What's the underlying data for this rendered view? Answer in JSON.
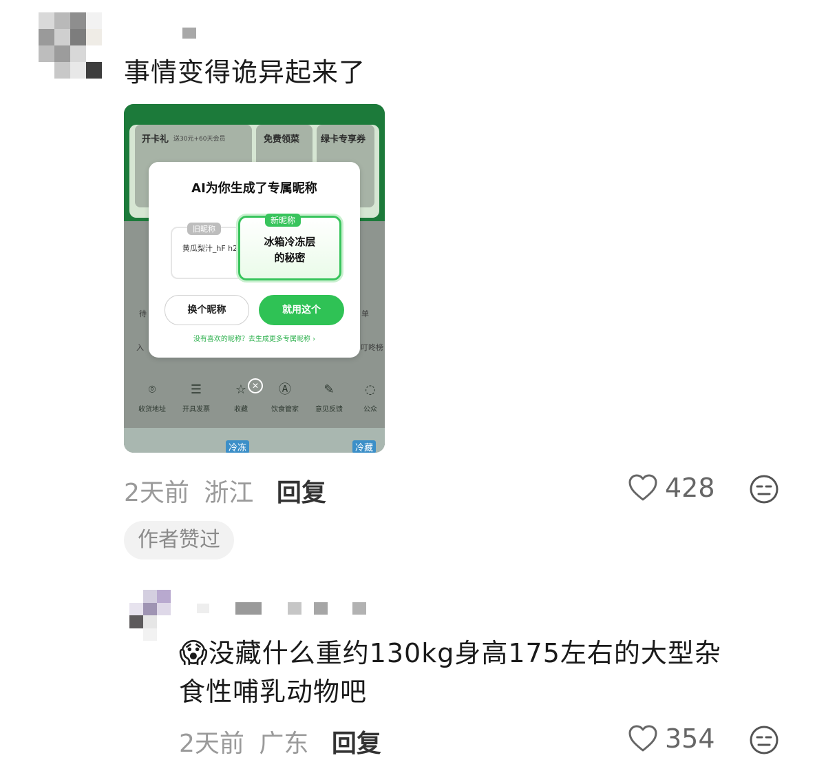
{
  "comment1": {
    "text": "事情变得诡异起来了",
    "time": "2天前",
    "location": "浙江",
    "reply_label": "回复",
    "likes": "428",
    "author_liked": "作者赞过"
  },
  "embedded_screenshot": {
    "tiles": [
      "开卡礼",
      "免费领菜",
      "绿卡专享券"
    ],
    "gift_subtitle": "送30元+60天会员",
    "modal": {
      "title": "AI为你生成了专属昵称",
      "old_badge": "旧昵称",
      "old_name": "黄瓜梨汁_hF h2",
      "new_badge": "新昵称",
      "new_name_line1": "冰箱冷冻层",
      "new_name_line2": "的秘密",
      "swap_button": "换个昵称",
      "use_button": "就用这个",
      "more_link": "没有喜欢的昵称？去生成更多专属昵称 ›"
    },
    "menu": [
      "收货地址",
      "开具发票",
      "收藏",
      "饮食管家",
      "意见反馈",
      "公众"
    ],
    "tags": [
      "冷冻",
      "冷藏"
    ]
  },
  "comment2": {
    "text_line1": "没藏什么重约130kg身高175左右的大型杂",
    "text_line2": "食性哺乳动物吧",
    "emoji": "😱",
    "time": "2天前",
    "location": "广东",
    "reply_label": "回复",
    "likes": "354"
  }
}
